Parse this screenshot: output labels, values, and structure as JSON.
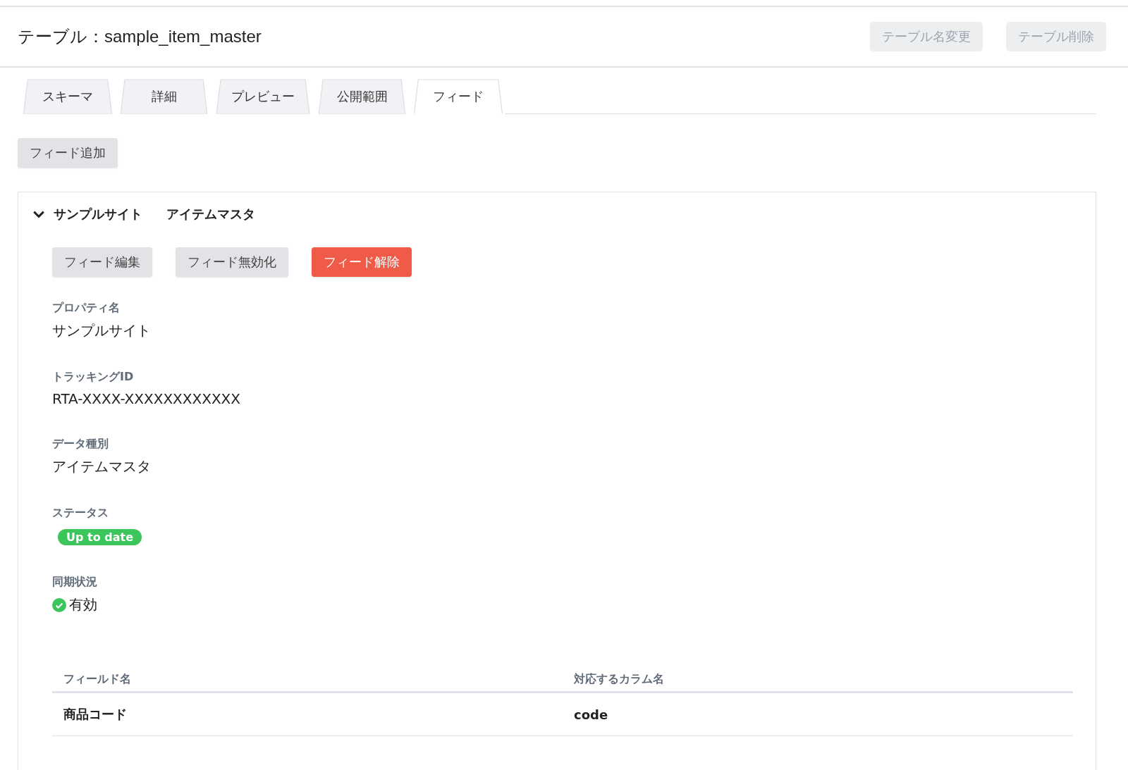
{
  "header": {
    "title": "テーブル：sample_item_master",
    "buttons": [
      {
        "label": "テーブル名変更",
        "disabled": true
      },
      {
        "label": "テーブル削除",
        "disabled": true
      }
    ]
  },
  "tabs": [
    {
      "label": "スキーマ",
      "selected": false
    },
    {
      "label": "詳細",
      "selected": false
    },
    {
      "label": "プレビュー",
      "selected": false
    },
    {
      "label": "公開範囲",
      "selected": false
    },
    {
      "label": "フィード",
      "selected": true
    }
  ],
  "add_button": "フィード追加",
  "feed": {
    "expanded": true,
    "property": "サンプルサイト",
    "data_type": "アイテムマスタ",
    "buttons": [
      {
        "label": "フィード編集",
        "kind": "default"
      },
      {
        "label": "フィード無効化",
        "kind": "default"
      },
      {
        "label": "フィード解除",
        "kind": "danger"
      }
    ],
    "fields": [
      {
        "label": "プロパティ名",
        "value": "サンプルサイト",
        "kind": "text"
      },
      {
        "label": "トラッキングID",
        "value": "RTA-XXXX-XXXXXXXXXXXX",
        "kind": "text"
      },
      {
        "label": "データ種別",
        "value": "アイテムマスタ",
        "kind": "text"
      },
      {
        "label": "ステータス",
        "value": "Up to date",
        "kind": "badge",
        "color": "#3cc55a"
      },
      {
        "label": "同期状況",
        "value": "有効",
        "kind": "check"
      }
    ],
    "table": {
      "columns": [
        "フィールド名",
        "対応するカラム名"
      ],
      "rows": [
        [
          "商品コード",
          "code"
        ]
      ]
    }
  }
}
